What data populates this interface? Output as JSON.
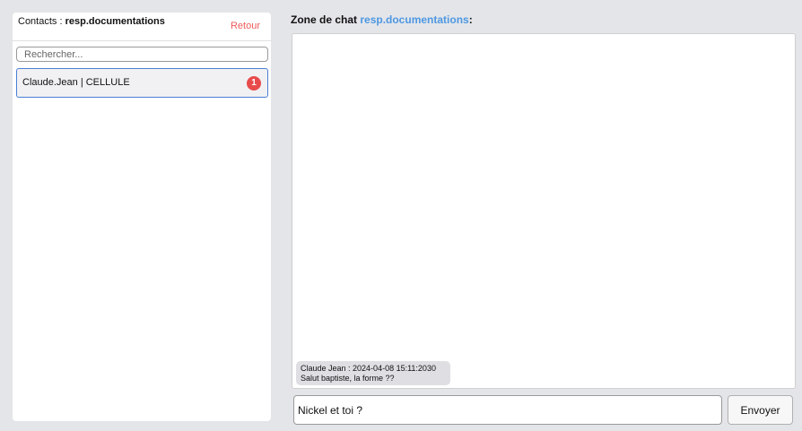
{
  "contacts": {
    "title_prefix": "Contacts : ",
    "current_user": "resp.documentations",
    "back_label": "Retour",
    "search_placeholder": "Rechercher...",
    "items": [
      {
        "label": "Claude.Jean | CELLULE",
        "unread": "1"
      }
    ]
  },
  "chat": {
    "heading_prefix": "Zone de chat ",
    "heading_user": "resp.documentations",
    "heading_suffix": ":",
    "messages": [
      {
        "meta": "Claude Jean : 2024-04-08 15:11:2030",
        "text": "Salut baptiste, la forme ??"
      }
    ],
    "input_value": "Nickel et toi ?",
    "send_label": "Envoyer"
  }
}
